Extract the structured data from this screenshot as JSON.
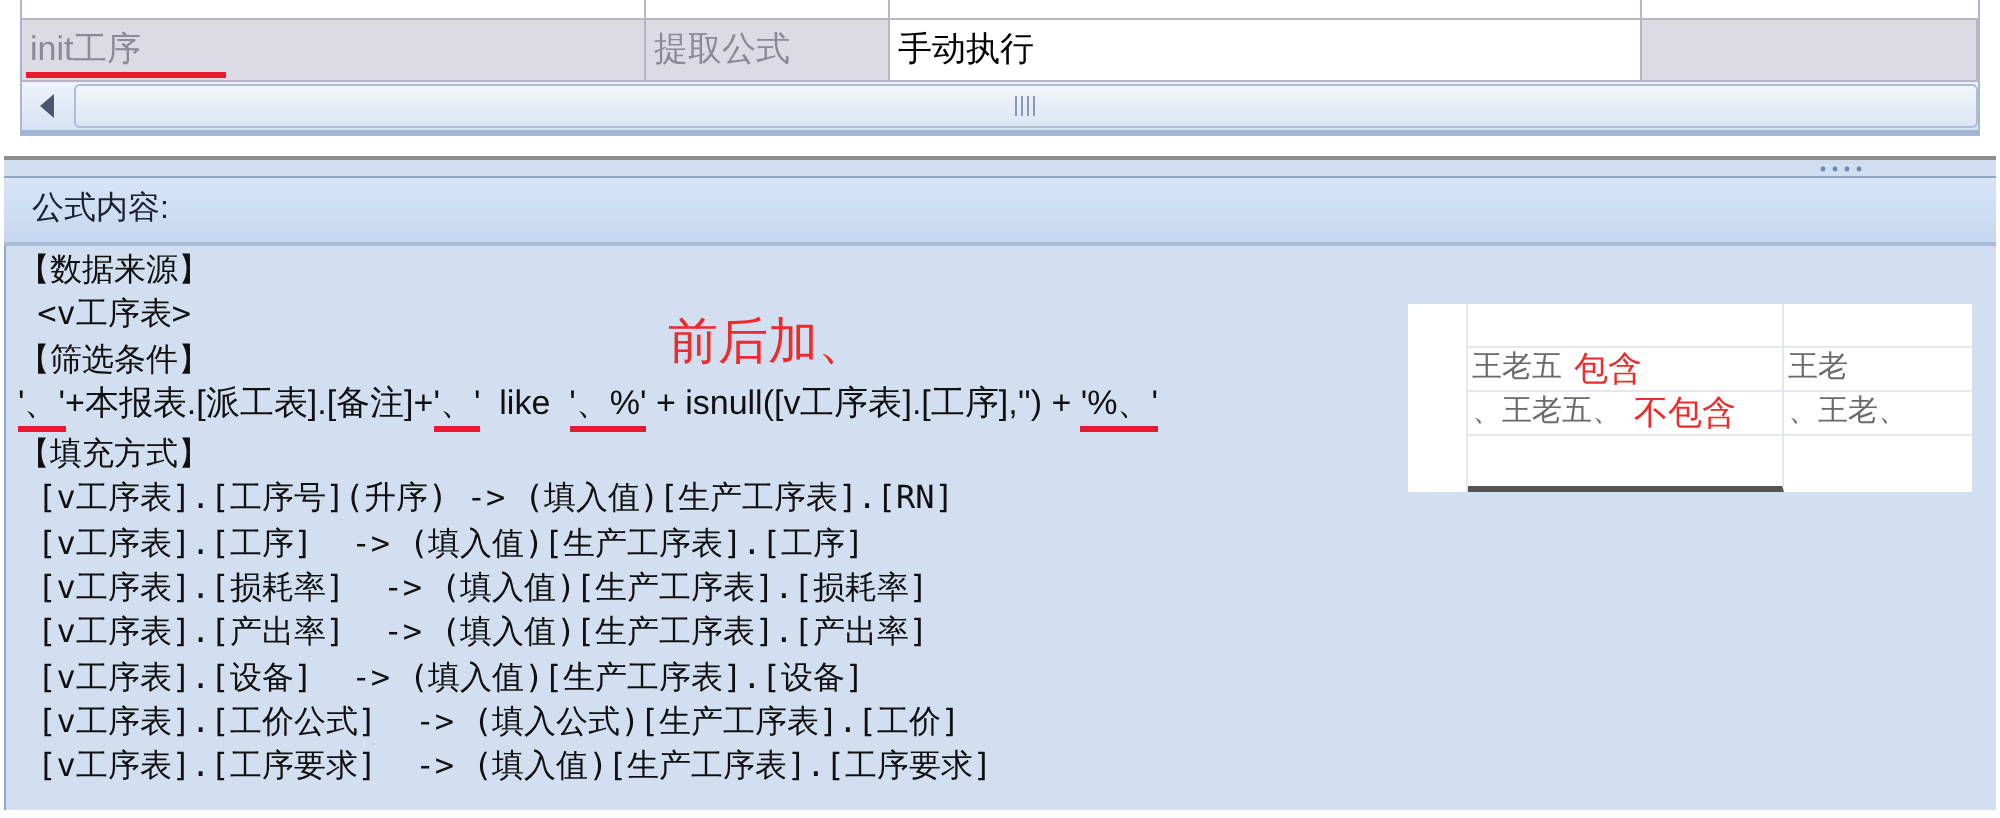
{
  "grid": {
    "rows": [
      {
        "cells": [
          {
            "text": "init工序",
            "kind": "readonly",
            "annotated": true
          },
          {
            "text": "提取公式",
            "kind": "readonly",
            "annotated": false
          },
          {
            "text": "手动执行",
            "kind": "editable",
            "annotated": false
          },
          {
            "kind": "readonly",
            "annotated": false
          }
        ]
      }
    ]
  },
  "panel": {
    "title": "公式内容:"
  },
  "formula": {
    "lines": [
      {
        "kind": "text",
        "text": "【数据来源】"
      },
      {
        "kind": "text",
        "text": " <v工序表>"
      },
      {
        "kind": "text",
        "text": "【筛选条件】"
      },
      {
        "kind": "segments",
        "segments": [
          {
            "text": "'、'",
            "underlined": true
          },
          {
            "text": "+本报表.[派工表].[备注]+",
            "underlined": false
          },
          {
            "text": "'、'",
            "underlined": true
          },
          {
            "text": "  like  ",
            "underlined": false
          },
          {
            "text": "'、%'",
            "underlined": true
          },
          {
            "text": " + isnull([v工序表].[工序],'') + ",
            "underlined": false
          },
          {
            "text": "'%、'",
            "underlined": true
          }
        ]
      },
      {
        "kind": "text",
        "text": "【填充方式】"
      },
      {
        "kind": "text",
        "text": " [v工序表].[工序号](升序) -> (填入值)[生产工序表].[RN]"
      },
      {
        "kind": "text",
        "text": " [v工序表].[工序]  -> (填入值)[生产工序表].[工序]"
      },
      {
        "kind": "text",
        "text": " [v工序表].[损耗率]  -> (填入值)[生产工序表].[损耗率]"
      },
      {
        "kind": "text",
        "text": " [v工序表].[产出率]  -> (填入值)[生产工序表].[产出率]"
      },
      {
        "kind": "text",
        "text": " [v工序表].[设备]  -> (填入值)[生产工序表].[设备]"
      },
      {
        "kind": "text",
        "text": " [v工序表].[工价公式]  -> (填入公式)[生产工序表].[工价]"
      },
      {
        "kind": "text",
        "text": " [v工序表].[工序要求]  -> (填入值)[生产工序表].[工序要求]"
      }
    ]
  },
  "annotation": {
    "text": "前后加、"
  },
  "example": {
    "cells": [
      {
        "text": "王老五",
        "note": "包含"
      },
      {
        "text": "、王老五、",
        "note": "不包含"
      },
      {
        "text": "王老"
      },
      {
        "text": "、王老、"
      }
    ]
  }
}
